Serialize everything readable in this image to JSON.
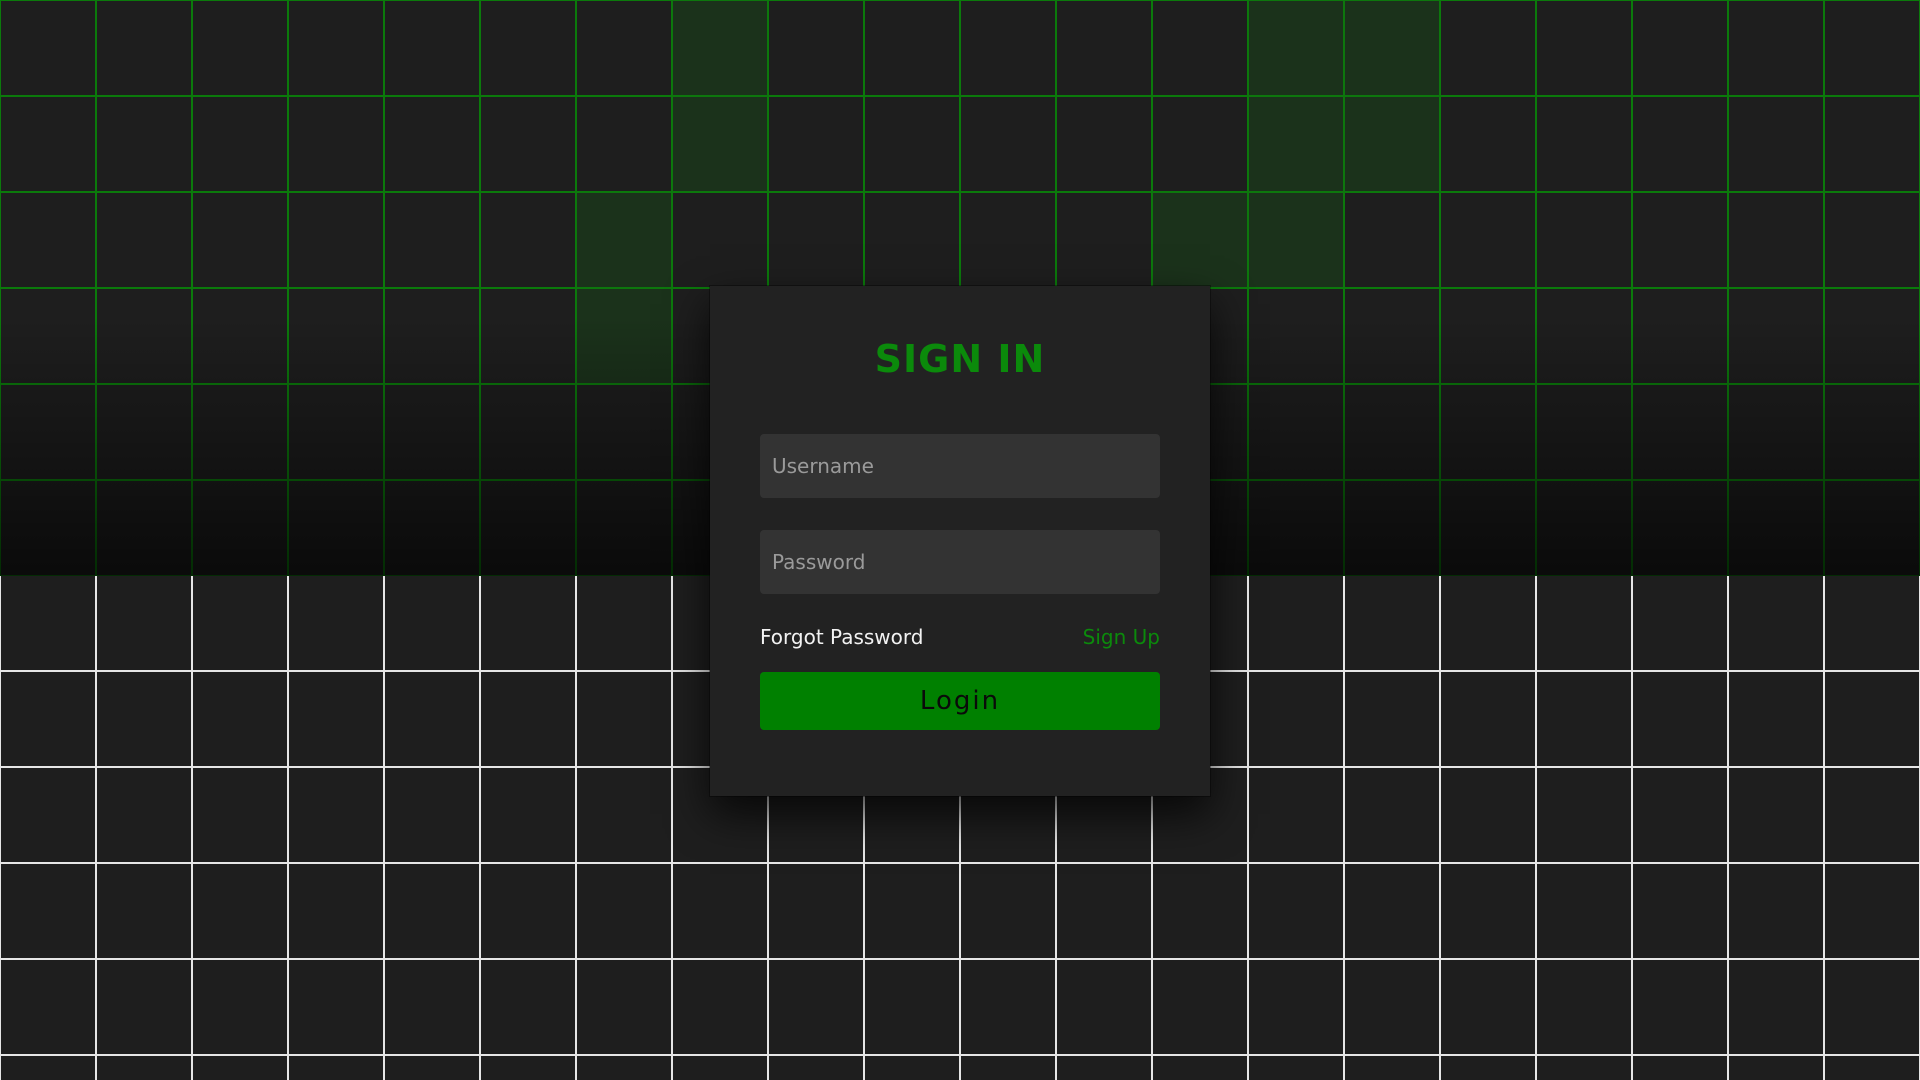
{
  "form": {
    "title": "SIGN IN",
    "username_placeholder": "Username",
    "password_placeholder": "Password",
    "forgot_password_label": "Forgot Password",
    "sign_up_label": "Sign Up",
    "login_label": "Login"
  },
  "colors": {
    "accent": "#008000",
    "card_background": "#222222",
    "input_background": "#333333",
    "grid_top_lines": "#0b7a0b",
    "grid_bottom_lines": "#e6e6e6",
    "page_background": "#1e1e1e"
  }
}
